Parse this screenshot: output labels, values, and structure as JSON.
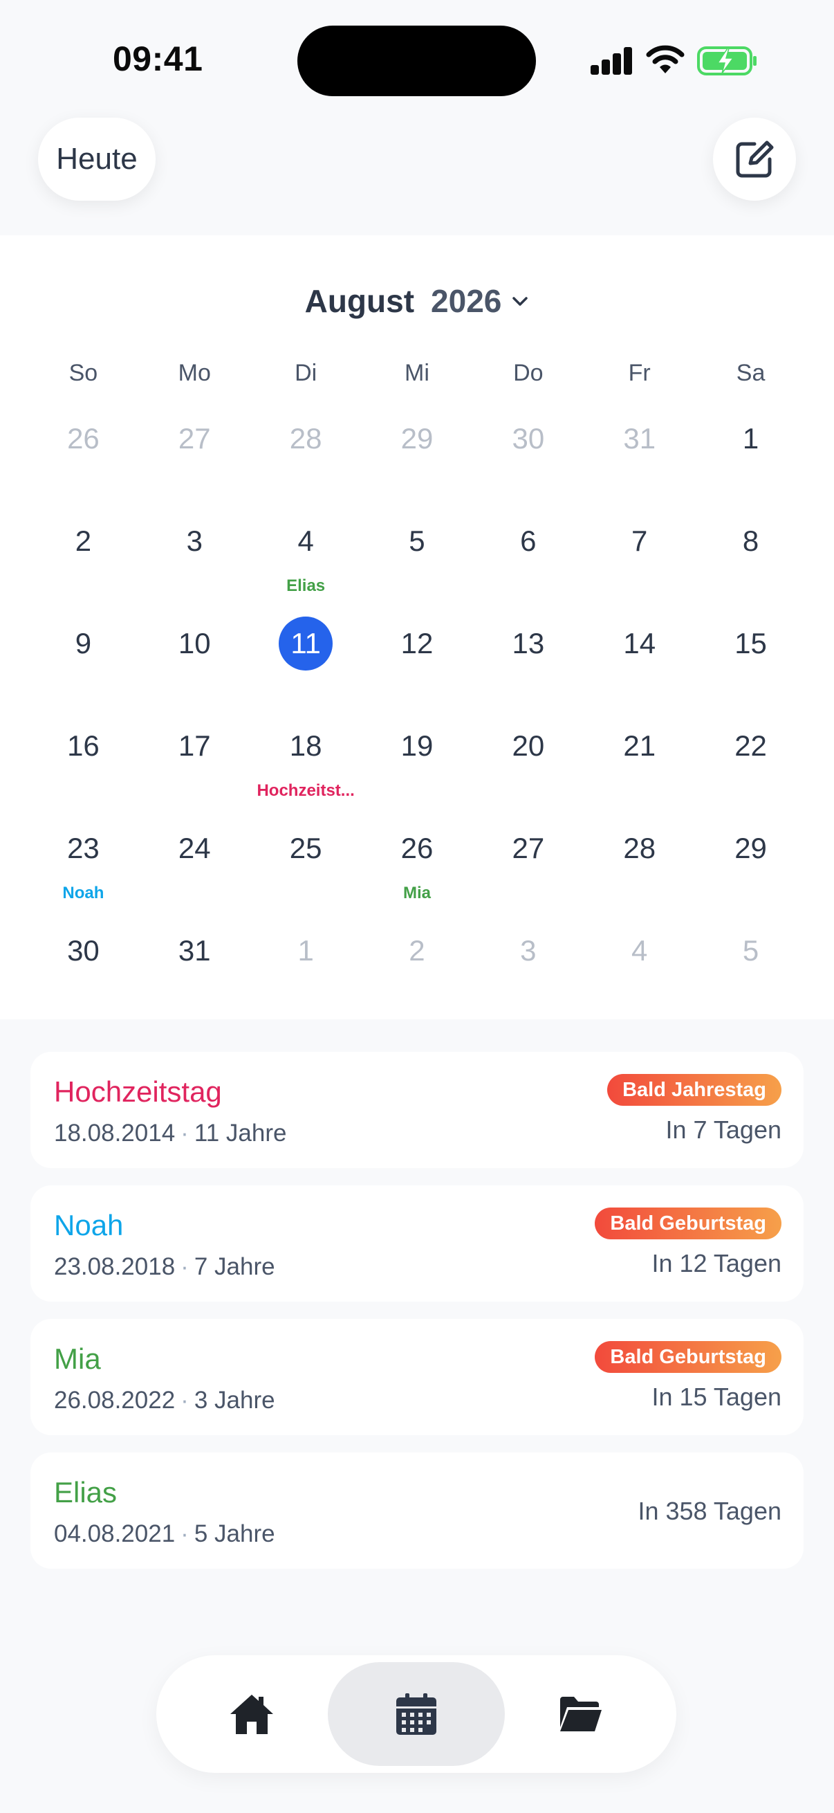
{
  "status_bar": {
    "time": "09:41",
    "icons": [
      "signal-icon",
      "wifi-icon",
      "battery-charging-icon"
    ],
    "battery_color": "#4cd964"
  },
  "header": {
    "today_label": "Heute",
    "compose_icon": "compose-icon"
  },
  "calendar": {
    "month": "August",
    "year": "2026",
    "selected_color": "#2563eb",
    "weekdays": [
      "So",
      "Mo",
      "Di",
      "Mi",
      "Do",
      "Fr",
      "Sa"
    ],
    "days": [
      {
        "n": "26",
        "muted": true
      },
      {
        "n": "27",
        "muted": true
      },
      {
        "n": "28",
        "muted": true
      },
      {
        "n": "29",
        "muted": true
      },
      {
        "n": "30",
        "muted": true
      },
      {
        "n": "31",
        "muted": true
      },
      {
        "n": "1"
      },
      {
        "n": "2"
      },
      {
        "n": "3"
      },
      {
        "n": "4",
        "event": "Elias",
        "color": "#43a047"
      },
      {
        "n": "5"
      },
      {
        "n": "6"
      },
      {
        "n": "7"
      },
      {
        "n": "8"
      },
      {
        "n": "9"
      },
      {
        "n": "10"
      },
      {
        "n": "11",
        "selected": true
      },
      {
        "n": "12"
      },
      {
        "n": "13"
      },
      {
        "n": "14"
      },
      {
        "n": "15"
      },
      {
        "n": "16"
      },
      {
        "n": "17"
      },
      {
        "n": "18",
        "event": "Hochzeitst...",
        "color": "#e0245e"
      },
      {
        "n": "19"
      },
      {
        "n": "20"
      },
      {
        "n": "21"
      },
      {
        "n": "22"
      },
      {
        "n": "23",
        "event": "Noah",
        "color": "#0ea5e9"
      },
      {
        "n": "24"
      },
      {
        "n": "25"
      },
      {
        "n": "26",
        "event": "Mia",
        "color": "#43a047"
      },
      {
        "n": "27"
      },
      {
        "n": "28"
      },
      {
        "n": "29"
      },
      {
        "n": "30"
      },
      {
        "n": "31"
      },
      {
        "n": "1",
        "muted": true
      },
      {
        "n": "2",
        "muted": true
      },
      {
        "n": "3",
        "muted": true
      },
      {
        "n": "4",
        "muted": true
      },
      {
        "n": "5",
        "muted": true
      }
    ]
  },
  "events": [
    {
      "title": "Hochzeitstag",
      "color": "#e0245e",
      "date": "18.08.2014",
      "age": "11 Jahre",
      "badge": "Bald Jahrestag",
      "countdown": "In 7 Tagen"
    },
    {
      "title": "Noah",
      "color": "#0ea5e9",
      "date": "23.08.2018",
      "age": "7 Jahre",
      "badge": "Bald Geburtstag",
      "countdown": "In 12 Tagen"
    },
    {
      "title": "Mia",
      "color": "#43a047",
      "date": "26.08.2022",
      "age": "3 Jahre",
      "badge": "Bald Geburtstag",
      "countdown": "In 15 Tagen"
    },
    {
      "title": "Elias",
      "color": "#43a047",
      "date": "04.08.2021",
      "age": "5 Jahre",
      "badge": "",
      "countdown": "In 358 Tagen"
    }
  ],
  "separator": "·",
  "tabbar": {
    "tabs": [
      {
        "icon": "home-icon",
        "active": false
      },
      {
        "icon": "calendar-icon",
        "active": true
      },
      {
        "icon": "folder-icon",
        "active": false
      }
    ]
  }
}
